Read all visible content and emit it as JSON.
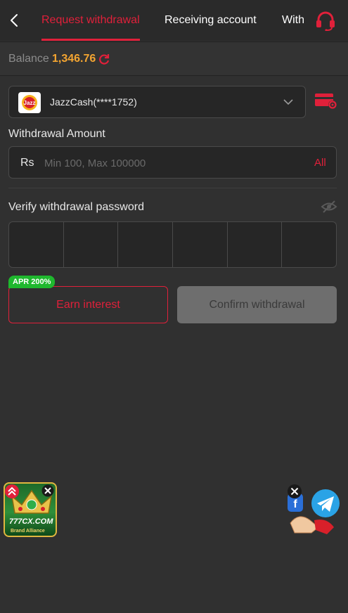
{
  "header": {
    "back_icon": "chevron-left-icon",
    "tabs": [
      {
        "label": "Request withdrawal",
        "active": true
      },
      {
        "label": "Receiving account",
        "active": false
      },
      {
        "label": "With",
        "active": false
      }
    ],
    "support_icon": "headset-icon"
  },
  "balance": {
    "label": "Balance",
    "value": "1,346.76",
    "refresh_icon": "refresh-icon"
  },
  "account": {
    "logo_text": "Jazz",
    "label": "JazzCash(****1752)",
    "dropdown_icon": "chevron-down-icon",
    "manage_icon": "card-settings-icon"
  },
  "amount": {
    "label": "Withdrawal Amount",
    "currency": "Rs",
    "placeholder": "Min 100, Max 100000",
    "value": "",
    "all_label": "All"
  },
  "password": {
    "label": "Verify withdrawal password",
    "visibility_icon": "eye-off-icon",
    "digits": [
      "",
      "",
      "",
      "",
      "",
      ""
    ]
  },
  "actions": {
    "apr_badge": "APR 200%",
    "earn_label": "Earn interest",
    "confirm_label": "Confirm withdrawal"
  },
  "floating": {
    "promo_text": "777CX.COM",
    "promo_sub": "Brand Alliance",
    "promo_icon": "crown-icon",
    "social_icon": "telegram-facebook-icon"
  },
  "colors": {
    "accent": "#e0203a",
    "balance": "#f4a531",
    "badge": "#1fb82e",
    "background": "#303030"
  }
}
